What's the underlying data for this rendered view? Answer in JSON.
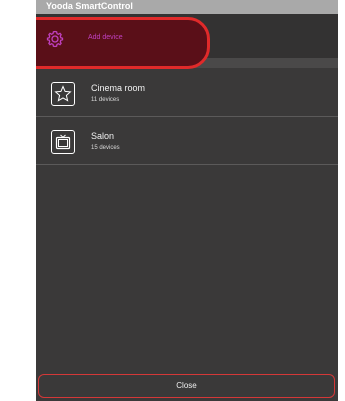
{
  "window": {
    "title": "Yooda SmartControl"
  },
  "add_device": {
    "label": "Add device",
    "icon": "gear-icon",
    "highlight_color": "#e02a2a"
  },
  "rooms": [
    {
      "name": "Cinema room",
      "count": "11 devices",
      "icon": "star-icon"
    },
    {
      "name": "Salon",
      "count": "15 devices",
      "icon": "tv-icon"
    }
  ],
  "footer": {
    "close_label": "Close"
  }
}
